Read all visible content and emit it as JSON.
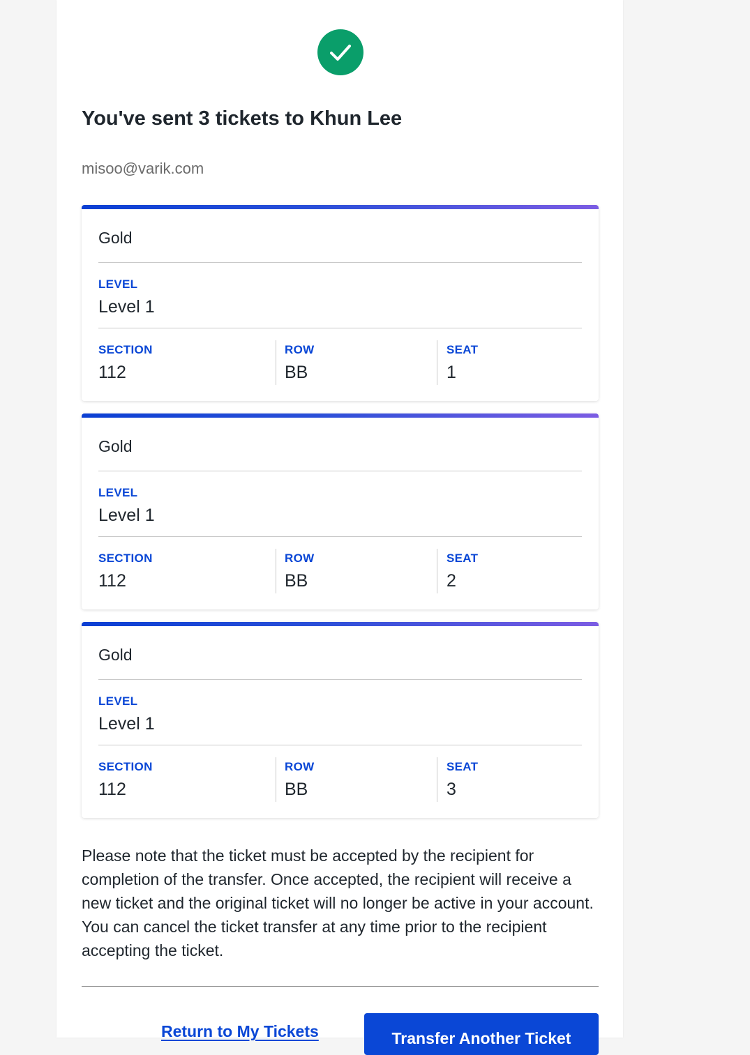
{
  "header": {
    "title": "You've sent 3 tickets to Khun Lee",
    "recipient_email": "misoo@varik.com",
    "success_icon": "check-circle-icon",
    "success_color": "#0a9e6a"
  },
  "labels": {
    "level": "LEVEL",
    "section": "SECTION",
    "row": "ROW",
    "seat": "SEAT"
  },
  "tickets": [
    {
      "type": "Gold",
      "level": "Level 1",
      "section": "112",
      "row": "BB",
      "seat": "1"
    },
    {
      "type": "Gold",
      "level": "Level 1",
      "section": "112",
      "row": "BB",
      "seat": "2"
    },
    {
      "type": "Gold",
      "level": "Level 1",
      "section": "112",
      "row": "BB",
      "seat": "3"
    }
  ],
  "note": "Please note that the ticket must be accepted by the recipient for completion of the transfer. Once accepted, the recipient will receive a new ticket and the original ticket will no longer be active in your account. You can cancel the ticket transfer at any time prior to the recipient accepting the ticket.",
  "actions": {
    "return_label": "Return to My Tickets",
    "transfer_label": "Transfer Another Ticket"
  },
  "colors": {
    "accent": "#0a47d6",
    "ticket_bar_start": "#0b3fd3",
    "ticket_bar_end": "#7b5ce3"
  }
}
